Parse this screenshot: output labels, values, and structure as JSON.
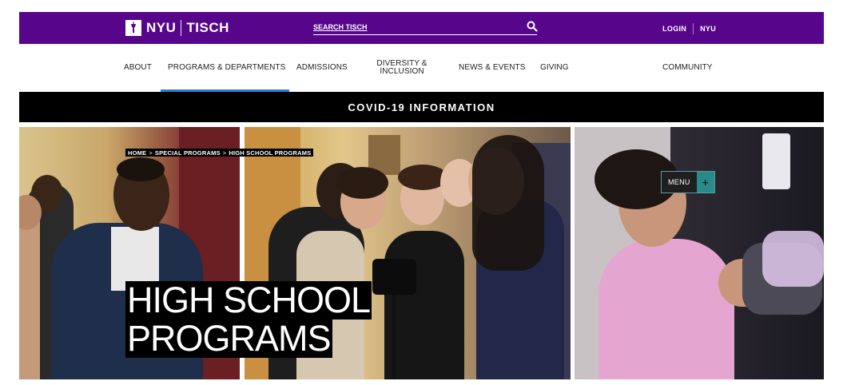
{
  "header": {
    "logo_nyu": "NYU",
    "logo_school": "TISCH",
    "search_placeholder": "SEARCH TISCH",
    "login_label": "LOGIN",
    "nyu_link_label": "NYU",
    "brand_color": "#57068c"
  },
  "nav": {
    "items": [
      {
        "label": "ABOUT"
      },
      {
        "label": "PROGRAMS & DEPARTMENTS",
        "active": true
      },
      {
        "label": "ADMISSIONS"
      },
      {
        "label": "DIVERSITY & INCLUSION"
      },
      {
        "label": "NEWS & EVENTS"
      },
      {
        "label": "GIVING"
      },
      {
        "label": "COMMUNITY"
      }
    ],
    "active_color": "#2a7fd4"
  },
  "covid_banner": {
    "label": "COVID-19 INFORMATION"
  },
  "breadcrumb": {
    "items": [
      "HOME",
      "SPECIAL PROGRAMS",
      "HIGH SCHOOL PROGRAMS"
    ],
    "separator": ">"
  },
  "hero": {
    "title_line1": "HIGH SCHOOL",
    "title_line2": "PROGRAMS"
  },
  "menu_button": {
    "label": "MENU",
    "icon": "plus-icon"
  }
}
